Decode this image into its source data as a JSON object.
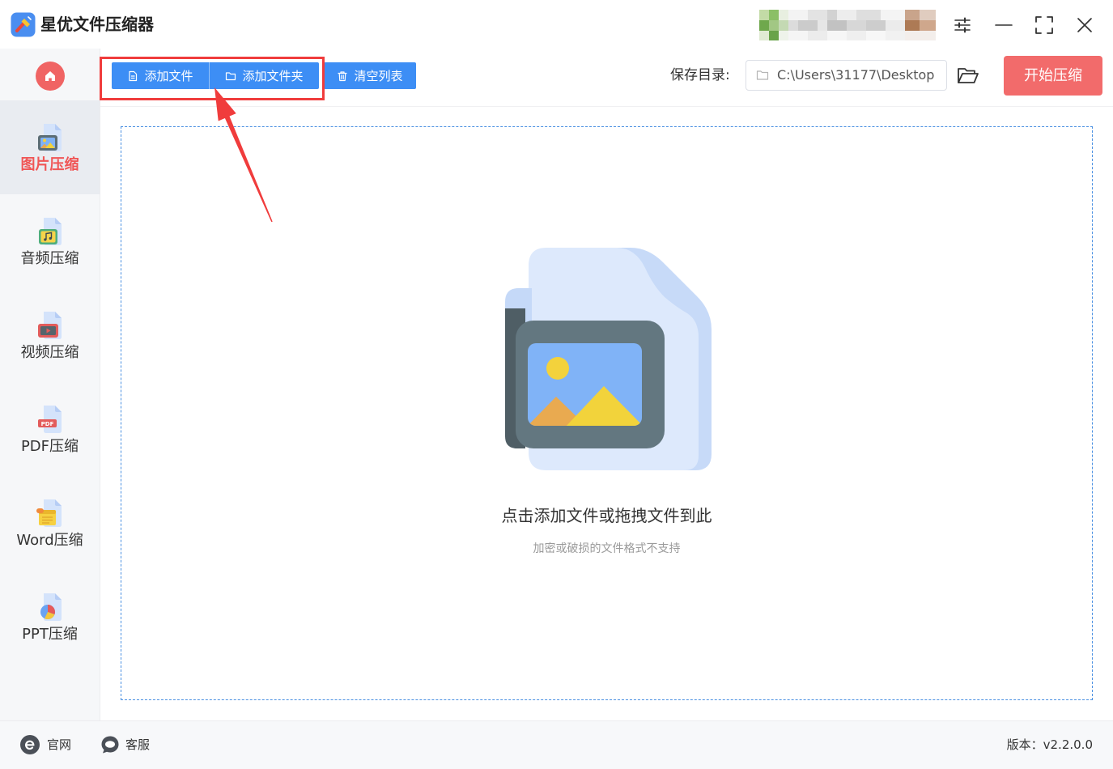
{
  "app": {
    "title": "星优文件压缩器",
    "logo_icon": "app-logo-icon"
  },
  "titlebar": {
    "avatar_icon": "user-avatar",
    "icons": [
      "settings-sliders-icon",
      "minimize-icon",
      "maximize-icon",
      "close-icon"
    ]
  },
  "sidebar": {
    "home_icon": "home-icon",
    "items": [
      {
        "label": "图片压缩",
        "icon": "image-compress-icon",
        "active": true
      },
      {
        "label": "音频压缩",
        "icon": "audio-compress-icon",
        "active": false
      },
      {
        "label": "视频压缩",
        "icon": "video-compress-icon",
        "active": false
      },
      {
        "label": "PDF压缩",
        "icon": "pdf-compress-icon",
        "active": false,
        "icon_text": "PDF"
      },
      {
        "label": "Word压缩",
        "icon": "word-compress-icon",
        "active": false
      },
      {
        "label": "PPT压缩",
        "icon": "ppt-compress-icon",
        "active": false
      }
    ]
  },
  "toolbar": {
    "add_file": {
      "label": "添加文件",
      "icon": "file-icon"
    },
    "add_folder": {
      "label": "添加文件夹",
      "icon": "folder-icon"
    },
    "clear_list": {
      "label": "清空列表",
      "icon": "trash-icon"
    },
    "save_dir": {
      "label": "保存目录:",
      "value": "C:\\Users\\31177\\Desktop",
      "icon": "folder-icon"
    },
    "browse_icon": "folder-open-icon",
    "start": {
      "label": "开始压缩"
    }
  },
  "dropzone": {
    "illustration": "image-file-illustration",
    "primary_text": "点击添加文件或拖拽文件到此",
    "secondary_text": "加密或破损的文件格式不支持"
  },
  "footer": {
    "website": {
      "label": "官网",
      "icon": "ie-icon"
    },
    "support": {
      "label": "客服",
      "icon": "chat-icon"
    },
    "version": "版本：v2.2.0.0"
  },
  "colors": {
    "accent_blue": "#3d8ef5",
    "start_red": "#f26b6b",
    "active_red": "#f05656",
    "home_red": "#f06464",
    "annotation_red": "#f03c3c",
    "dropzone_border": "#4a90e2"
  }
}
